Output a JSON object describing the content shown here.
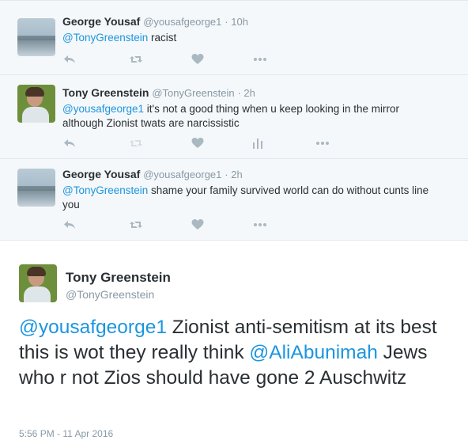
{
  "replies": [
    {
      "fullname": "George Yousaf",
      "handle": "@yousafgeorge1",
      "time": "· 10h",
      "mention": "@TonyGreenstein",
      "text": " racist",
      "text_cont": ""
    },
    {
      "fullname": "Tony Greenstein",
      "handle": "@TonyGreenstein",
      "time": "· 2h",
      "mention": "@yousafgeorge1",
      "text": " it's not a good thing when u keep looking in the mirror",
      "text_cont": "although Zionist twats are narcissistic"
    },
    {
      "fullname": "George Yousaf",
      "handle": "@yousafgeorge1",
      "time": "· 2h",
      "mention": "@TonyGreenstein",
      "text": " shame your family survived world can do without cunts line",
      "text_cont": "you"
    }
  ],
  "main_tweet": {
    "fullname": "Tony Greenstein",
    "handle": "@TonyGreenstein",
    "mention1": "@yousafgeorge1",
    "text1": " Zionist anti-semitism at its best this is wot they really think ",
    "mention2": "@AliAbunimah",
    "text2": " Jews who r not Zios should have gone 2 Auschwitz",
    "timestamp": "5:56 PM - 11 Apr 2016"
  },
  "icons": {
    "reply": "reply-icon",
    "retweet": "retweet-icon",
    "like": "heart-icon",
    "analytics": "analytics-icon",
    "more": "more-icon"
  },
  "colors": {
    "link": "#1b95e0",
    "text": "#292f33",
    "muted": "#8899a6",
    "reply_bg": "#f5f8fa"
  }
}
